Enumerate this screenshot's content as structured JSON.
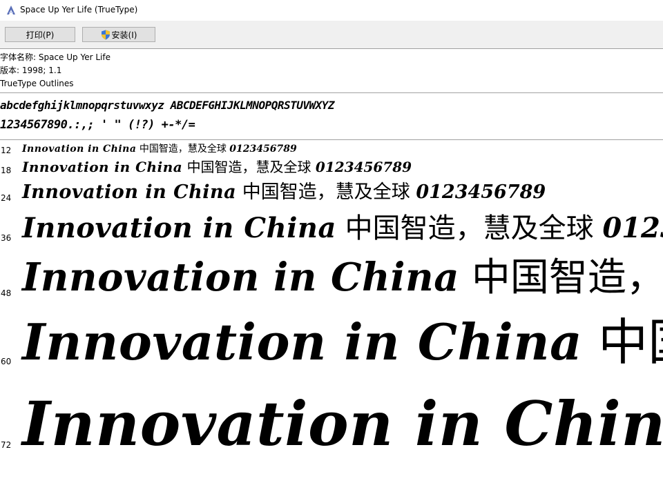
{
  "window": {
    "title": "Space Up Yer Life (TrueType)",
    "icon": "font-viewer-icon"
  },
  "toolbar": {
    "print_label": "打印(P)",
    "install_label": "安装(I)"
  },
  "info": {
    "font_name": "字体名称: Space Up Yer Life",
    "version": "版本: 1998; 1.1",
    "outline": "TrueType Outlines"
  },
  "charset": {
    "line1": "abcdefghijklmnopqrstuvwxyz ABCDEFGHIJKLMNOPQRSTUVWXYZ",
    "line2": "1234567890.:,; ' \" (!?) +-*/="
  },
  "sample": {
    "latin": "Innovation in China",
    "cjk": "中国智造，慧及全球",
    "digits": "0123456789"
  },
  "sizes": [
    "12",
    "18",
    "24",
    "36",
    "48",
    "60",
    "72"
  ]
}
